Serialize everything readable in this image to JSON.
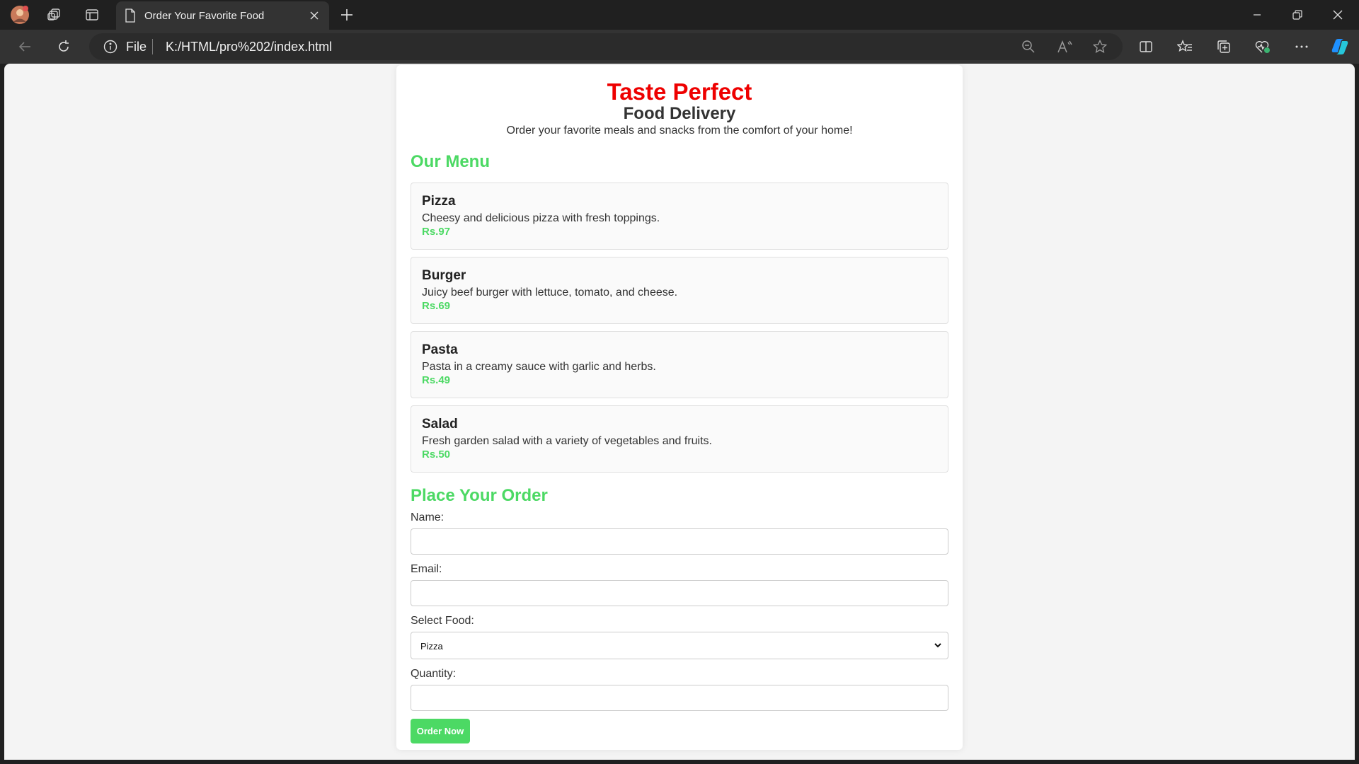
{
  "browser": {
    "tab_title": "Order Your Favorite Food",
    "protocol_label": "File",
    "url": "K:/HTML/pro%202/index.html"
  },
  "page": {
    "title": "Taste Perfect",
    "subtitle": "Food Delivery",
    "tagline": "Order your favorite meals and snacks from the comfort of your home!",
    "menu_heading": "Our Menu",
    "menu": [
      {
        "name": "Pizza",
        "description": "Cheesy and delicious pizza with fresh toppings.",
        "price": "Rs.97"
      },
      {
        "name": "Burger",
        "description": "Juicy beef burger with lettuce, tomato, and cheese.",
        "price": "Rs.69"
      },
      {
        "name": "Pasta",
        "description": "Pasta in a creamy sauce with garlic and herbs.",
        "price": "Rs.49"
      },
      {
        "name": "Salad",
        "description": "Fresh garden salad with a variety of vegetables and fruits.",
        "price": "Rs.50"
      }
    ],
    "order_heading": "Place Your Order",
    "form": {
      "name_label": "Name:",
      "name_value": "",
      "email_label": "Email:",
      "email_value": "",
      "food_label": "Select Food:",
      "food_selected": "Pizza",
      "quantity_label": "Quantity:",
      "quantity_value": "",
      "submit_label": "Order Now"
    }
  },
  "colors": {
    "title_red": "#ee0000",
    "accent_green": "#4cd964",
    "chrome_dark": "#202020",
    "chrome_toolbar": "#333333",
    "page_bg": "#f4f4f4"
  },
  "icons": {
    "tabbar": [
      "profile-avatar-icon",
      "workspaces-icon",
      "tab-actions-icon",
      "document-icon",
      "close-icon",
      "new-tab-icon",
      "minimize-icon",
      "restore-icon",
      "window-close-icon"
    ],
    "toolbar": [
      "back-icon",
      "refresh-icon",
      "info-icon",
      "zoom-out-icon",
      "read-aloud-icon",
      "favorite-star-icon",
      "split-screen-icon",
      "favorites-icon",
      "collections-icon",
      "browser-essentials-icon",
      "more-icon",
      "copilot-icon"
    ]
  }
}
